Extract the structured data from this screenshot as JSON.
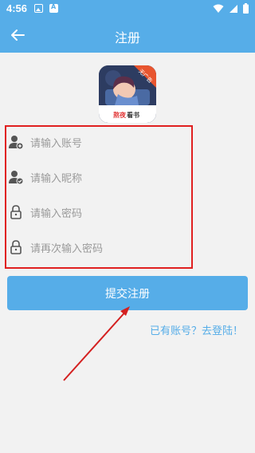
{
  "status_bar": {
    "time": "4:56"
  },
  "app_bar": {
    "title": "注册",
    "back_icon": "arrow-left-icon"
  },
  "logo": {
    "text_red": "熬夜",
    "text_dark": "看书",
    "badge": "无广告"
  },
  "form": {
    "fields": [
      {
        "placeholder": "请输入账号",
        "icon": "user-add-icon"
      },
      {
        "placeholder": "请输入昵称",
        "icon": "user-check-icon"
      },
      {
        "placeholder": "请输入密码",
        "icon": "lock-icon"
      },
      {
        "placeholder": "请再次输入密码",
        "icon": "lock-icon"
      }
    ]
  },
  "submit_label": "提交注册",
  "login_link": "已有账号？去登陆！",
  "colors": {
    "primary": "#56ade8",
    "highlight": "#e02020",
    "background": "#f2f2f2"
  }
}
